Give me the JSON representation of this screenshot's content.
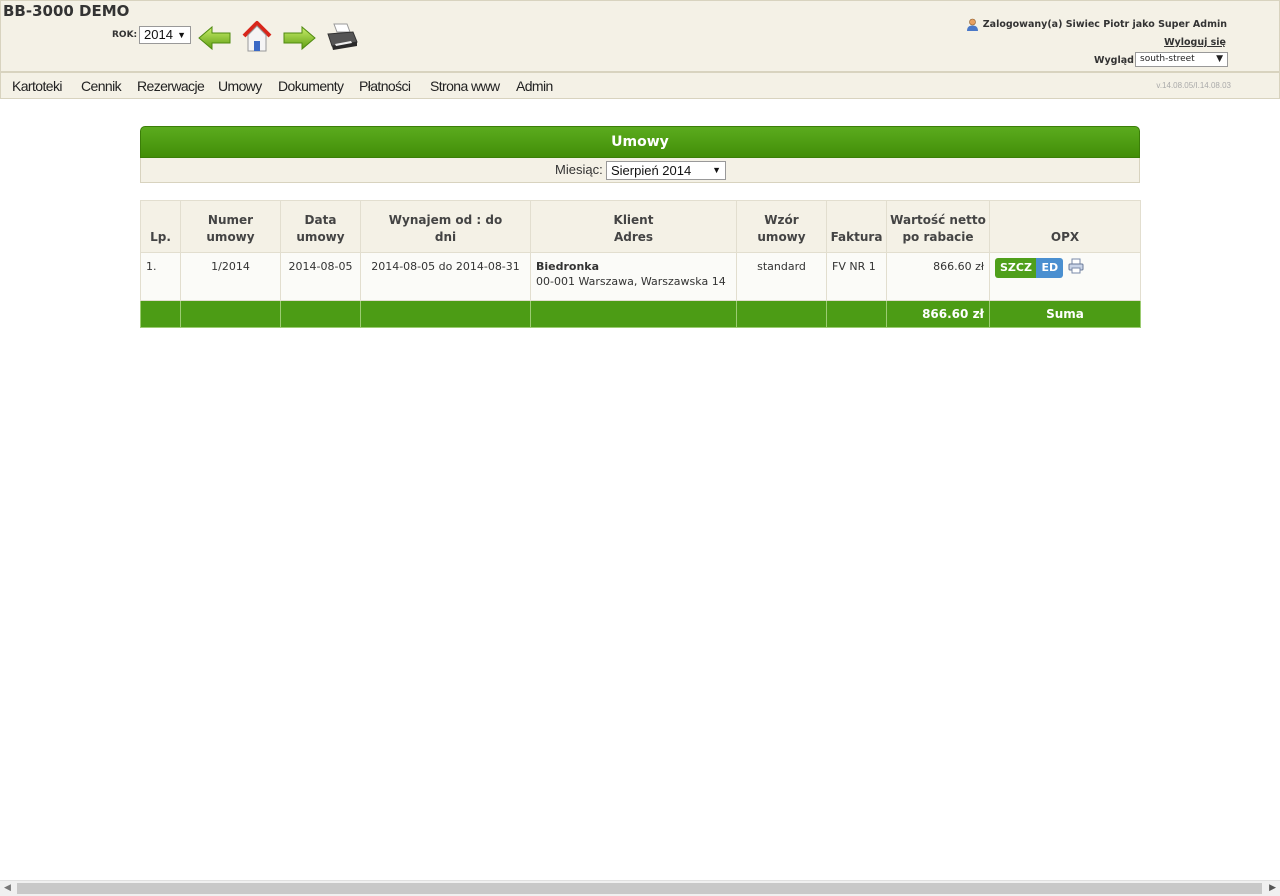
{
  "app": {
    "title": "BB-3000 DEMO"
  },
  "year": {
    "label": "ROK:",
    "selected": "2014"
  },
  "toolbar": {
    "prev_icon": "arrow-left-icon",
    "home_icon": "home-icon",
    "next_icon": "arrow-right-icon",
    "print_icon": "printer-icon"
  },
  "user": {
    "icon": "user-icon",
    "text": "Zalogowany(a) Siwiec Piotr jako Super Admin",
    "logout": "Wyloguj się"
  },
  "theme": {
    "label": "Wygląd:",
    "selected": "south-street"
  },
  "menu": {
    "items": [
      "Kartoteki",
      "Cennik",
      "Rezerwacje",
      "Umowy",
      "Dokumenty",
      "Płatności",
      "Strona www",
      "Admin"
    ],
    "version": "v.14.08.05/I.14.08.03"
  },
  "panel": {
    "title": "Umowy",
    "month_label": "Miesiąc:",
    "month_selected": "Sierpień 2014"
  },
  "table": {
    "headers": {
      "lp": "Lp.",
      "numer": "Numer umowy",
      "data_1": "Data",
      "data_2": "umowy",
      "wynajem_1": "Wynajem od : do",
      "wynajem_2": "dni",
      "klient_1": "Klient",
      "klient_2": "Adres",
      "wzor": "Wzór umowy",
      "faktura": "Faktura",
      "wartosc_1": "Wartość netto",
      "wartosc_2": "po rabacie",
      "opx": "OPX"
    },
    "rows": [
      {
        "lp": "1.",
        "numer": "1/2014",
        "data": "2014-08-05",
        "wynajem": "2014-08-05 do 2014-08-31",
        "klient": "Biedronka",
        "adres": "00-001 Warszawa, Warszawska 14",
        "wzor": "standard",
        "faktura": "FV NR 1",
        "wartosc": "866.60 zł",
        "btn_details": "SZCZ",
        "btn_edit": "ED"
      }
    ],
    "sum": {
      "value": "866.60 zł",
      "label": "Suma"
    }
  },
  "colors": {
    "accent_green": "#4c9c15",
    "header_bg": "#f4f1e6",
    "edit_blue": "#4a8fd0"
  }
}
